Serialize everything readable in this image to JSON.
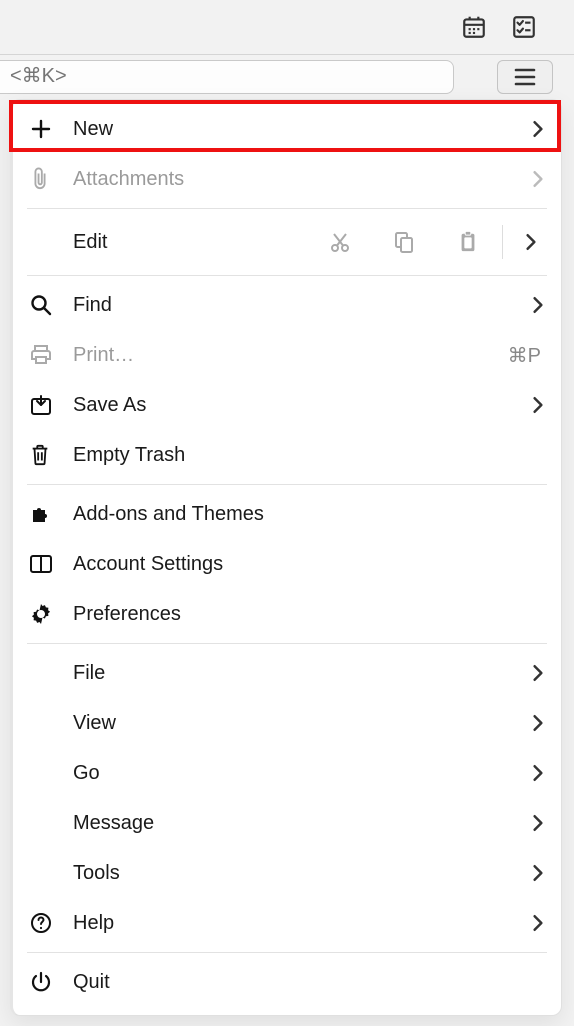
{
  "search": {
    "placeholder": "<⌘K>"
  },
  "menu": {
    "new": "New",
    "attachments": "Attachments",
    "edit": "Edit",
    "find": "Find",
    "print": "Print…",
    "print_shortcut": "⌘P",
    "save_as": "Save As",
    "empty_trash": "Empty Trash",
    "addons": "Add-ons and Themes",
    "account_settings": "Account Settings",
    "preferences": "Preferences",
    "file": "File",
    "view": "View",
    "go": "Go",
    "message": "Message",
    "tools": "Tools",
    "help": "Help",
    "quit": "Quit"
  }
}
